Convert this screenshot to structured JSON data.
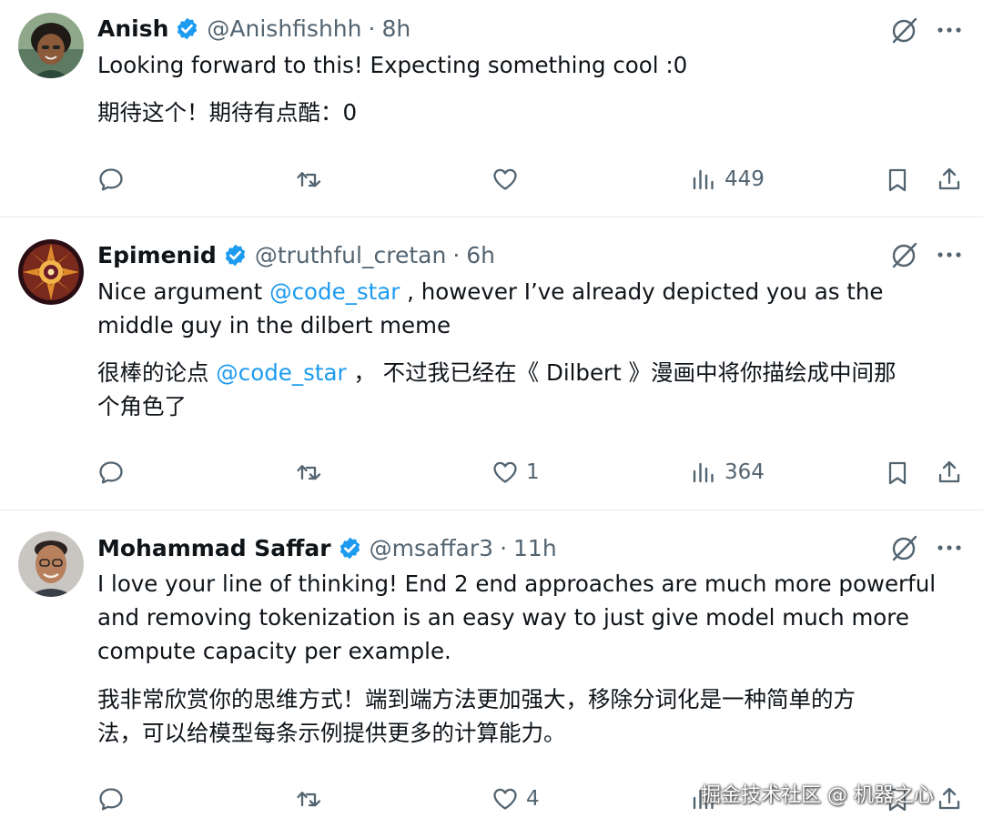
{
  "tweets": [
    {
      "name": "Anish",
      "handle": "@Anishfishhh",
      "separator": "·",
      "time": "8h",
      "line1": "Looking forward to this! Expecting something cool :0",
      "line2": "期待这个！期待有点酷：0",
      "views": "449",
      "avatar": "person-photo"
    },
    {
      "name": "Epimenid",
      "handle": "@truthful_cretan",
      "separator": "·",
      "time": "6h",
      "en_a": "Nice argument ",
      "mention": "@code_star",
      "en_b": " , however I’ve already depicted you as the",
      "en_c": "middle guy in the dilbert meme",
      "zh_a": "很棒的论点 ",
      "zh_mention": "@code_star",
      "zh_b": " ， 不过我已经在《 Dilbert 》漫画中将你描绘成中间那",
      "zh_c": "个角色了",
      "likes": "1",
      "views": "364",
      "avatar": "fractal-mandala"
    },
    {
      "name": "Mohammad Saffar",
      "handle": "@msaffar3",
      "separator": "·",
      "time": "11h",
      "en_1": "I love your line of thinking! End 2 end approaches are much more powerful",
      "en_2": "and removing tokenization is an easy way to just give model much more",
      "en_3": "compute capacity per example.",
      "zh_1": "我非常欣赏你的思维方式！端到端方法更加强大，移除分词化是一种简单的方",
      "zh_2": "法，可以给模型每条示例提供更多的计算能力。",
      "likes": "4",
      "avatar": "person-photo"
    }
  ],
  "watermark": "掘金技术社区 @ 机器之心",
  "colors": {
    "text": "#0f1419",
    "muted": "#536471",
    "link": "#1d9bf0",
    "verified": "#1d9bf0",
    "divider": "#e7e9ea"
  }
}
